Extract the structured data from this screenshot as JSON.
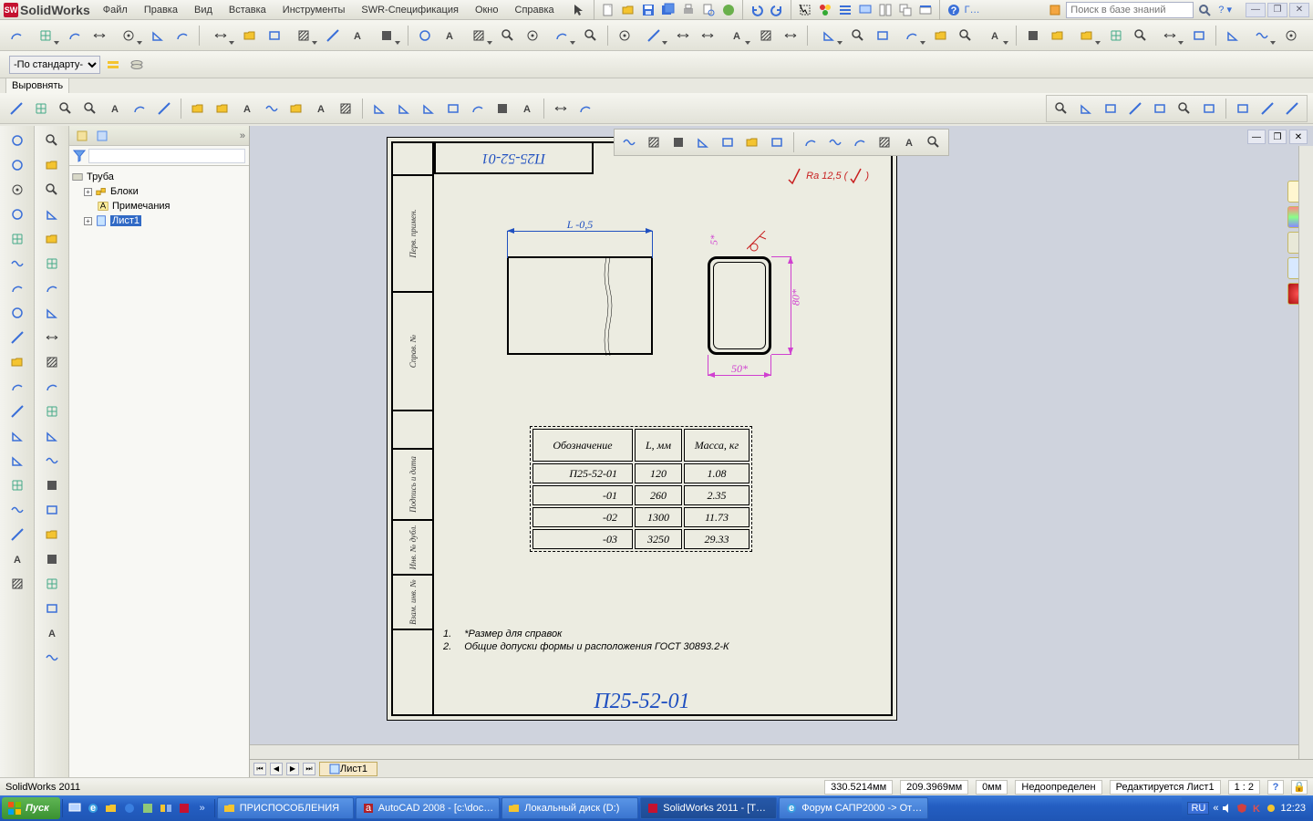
{
  "app": {
    "name": "SolidWorks"
  },
  "menu": [
    "Файл",
    "Правка",
    "Вид",
    "Вставка",
    "Инструменты",
    "SWR-Спецификация",
    "Окно",
    "Справка"
  ],
  "title_icons": [
    "cursor",
    "new",
    "open",
    "save",
    "saveall",
    "print",
    "print-preview",
    "publish",
    "undo",
    "redo",
    "select-arrow",
    "stoplight",
    "options",
    "display",
    "layout-tile",
    "layout-cascade",
    "rebuild",
    "help"
  ],
  "search": {
    "placeholder": "Поиск в базе знаний"
  },
  "std_dropdown": {
    "value": "-По стандарту-"
  },
  "align_label": "Выровнять",
  "row1": [
    "reflect",
    "tangent-arc",
    "3d-curve",
    "offset",
    "spline-fit",
    "fillet",
    "edit-sketch",
    "convert",
    "arrow",
    "trim-line",
    "angle",
    "equal",
    "dash",
    "toggle",
    "viewport",
    "rect",
    "rect-pattern",
    "revolve-dim",
    "baseline",
    "diameter",
    "circle",
    "circular",
    "ellipse",
    "ellipse-arc",
    "edge",
    "slot",
    "slot-arc",
    "wave",
    "table",
    "ordinate",
    "chain",
    "break",
    "text",
    "italic",
    "stack-up",
    "align-grid",
    "wave2",
    "sketch-line",
    "v-axis",
    "angle-dim",
    "perp",
    "balloon",
    "h-center",
    "item",
    "mouse"
  ],
  "row3": [
    "align-l",
    "align-r",
    "align-h",
    "align-v",
    "snap",
    "group",
    "gap",
    "dist-h",
    "dist-v",
    "vline",
    "lalign",
    "ralign",
    "calign",
    "balign",
    "eqh",
    "eqv",
    "tile",
    "auto",
    "color",
    "roughness",
    "lines1",
    "lines2",
    "legend"
  ],
  "row3_right": [
    "txt-a",
    "note",
    "balloon",
    "link",
    "tol",
    "weld",
    "copyf",
    "datum",
    "hatch",
    "scale"
  ],
  "canvas_tb": [
    "zoom-fit",
    "zoom-in",
    "zoom-out",
    "zoom-window",
    "section",
    "pan",
    "rotate",
    "prev-view",
    "orient",
    "style",
    "shade",
    "edges",
    "persp"
  ],
  "vtoolbar_left": [
    "sketch",
    "feature",
    "sheet",
    "assembly",
    "office",
    "line-tool",
    "curve",
    "annot",
    "arrow-t",
    "arc-t",
    "lwave",
    "options2",
    "dim",
    "hatch2",
    "slot2",
    "rect-tool",
    "folder",
    "cir",
    "sheet2"
  ],
  "vtoolbar_mid": [
    "note-a",
    "cloud",
    "text-t",
    "line",
    "spline",
    "polyline",
    "zoom",
    "auto-dim",
    "stretch",
    "rotate2",
    "arc3",
    "ruler",
    "textA",
    "sketch-arc",
    "gd-t",
    "move",
    "target",
    "arrow-d",
    "vline2",
    "fill",
    "hline",
    "block"
  ],
  "tree": {
    "root": "Труба",
    "children": [
      {
        "icon": "blocks",
        "label": "Блоки",
        "expandable": true
      },
      {
        "icon": "annot",
        "label": "Примечания",
        "expandable": false
      },
      {
        "icon": "sheet",
        "label": "Лист1",
        "expandable": true,
        "selected": true
      }
    ]
  },
  "sheet_tab": "Лист1",
  "drawing": {
    "title_top": "П25-52-01",
    "ra": "Ra 12,5",
    "left_cells": [
      "Перв. примен.",
      "Справ. №",
      "Подпись и дата",
      "Инв. № дубл.",
      "Взам. инв. №"
    ],
    "dim_L": "L -0,5",
    "dim_50": "50*",
    "dim_80": "80*",
    "dim_5": "5*",
    "table": {
      "head": [
        "Обозначение",
        "L, мм",
        "Масса, кг"
      ],
      "rows": [
        [
          "П25-52-01",
          "120",
          "1.08"
        ],
        [
          "-01",
          "260",
          "2.35"
        ],
        [
          "-02",
          "1300",
          "11.73"
        ],
        [
          "-03",
          "3250",
          "29.33"
        ]
      ]
    },
    "notes": [
      {
        "n": "1.",
        "t": "*Размер для справок"
      },
      {
        "n": "2.",
        "t": "Общие допуски формы и расположения ГОСТ 30893.2-К"
      }
    ],
    "big_label": "П25-52-01"
  },
  "status": {
    "app": "SolidWorks 2011",
    "x": "330.5214мм",
    "y": "209.3969мм",
    "z": "0мм",
    "state": "Недоопределен",
    "mode": "Редактируется Лист1",
    "scale": "1 : 2"
  },
  "taskbar": {
    "start": "Пуск",
    "tasks": [
      {
        "label": "ПРИСПОСОБЛЕНИЯ",
        "icon": "folder"
      },
      {
        "label": "AutoCAD 2008 - [c:\\doc…",
        "icon": "acad"
      },
      {
        "label": "Локальный диск (D:)",
        "icon": "folder"
      },
      {
        "label": "SolidWorks 2011 - [T…",
        "icon": "sw",
        "active": true
      },
      {
        "label": "Форум САПР2000 -> От…",
        "icon": "ie"
      }
    ],
    "tray_lang": "RU",
    "clock": "12:23"
  },
  "rdock": [
    "home",
    "appearances",
    "scene",
    "decal",
    "custom"
  ]
}
